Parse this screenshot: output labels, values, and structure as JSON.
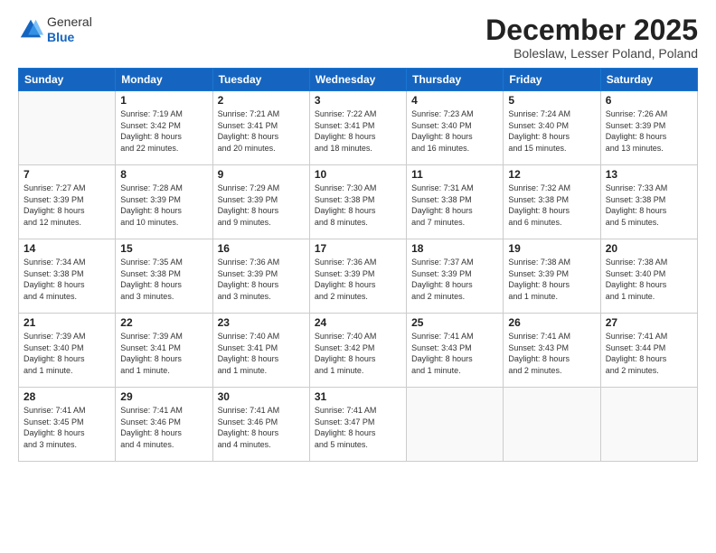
{
  "header": {
    "logo_line1": "General",
    "logo_line2": "Blue",
    "month_year": "December 2025",
    "location": "Boleslaw, Lesser Poland, Poland"
  },
  "weekdays": [
    "Sunday",
    "Monday",
    "Tuesday",
    "Wednesday",
    "Thursday",
    "Friday",
    "Saturday"
  ],
  "weeks": [
    [
      {
        "day": "",
        "info": ""
      },
      {
        "day": "1",
        "info": "Sunrise: 7:19 AM\nSunset: 3:42 PM\nDaylight: 8 hours\nand 22 minutes."
      },
      {
        "day": "2",
        "info": "Sunrise: 7:21 AM\nSunset: 3:41 PM\nDaylight: 8 hours\nand 20 minutes."
      },
      {
        "day": "3",
        "info": "Sunrise: 7:22 AM\nSunset: 3:41 PM\nDaylight: 8 hours\nand 18 minutes."
      },
      {
        "day": "4",
        "info": "Sunrise: 7:23 AM\nSunset: 3:40 PM\nDaylight: 8 hours\nand 16 minutes."
      },
      {
        "day": "5",
        "info": "Sunrise: 7:24 AM\nSunset: 3:40 PM\nDaylight: 8 hours\nand 15 minutes."
      },
      {
        "day": "6",
        "info": "Sunrise: 7:26 AM\nSunset: 3:39 PM\nDaylight: 8 hours\nand 13 minutes."
      }
    ],
    [
      {
        "day": "7",
        "info": "Sunrise: 7:27 AM\nSunset: 3:39 PM\nDaylight: 8 hours\nand 12 minutes."
      },
      {
        "day": "8",
        "info": "Sunrise: 7:28 AM\nSunset: 3:39 PM\nDaylight: 8 hours\nand 10 minutes."
      },
      {
        "day": "9",
        "info": "Sunrise: 7:29 AM\nSunset: 3:39 PM\nDaylight: 8 hours\nand 9 minutes."
      },
      {
        "day": "10",
        "info": "Sunrise: 7:30 AM\nSunset: 3:38 PM\nDaylight: 8 hours\nand 8 minutes."
      },
      {
        "day": "11",
        "info": "Sunrise: 7:31 AM\nSunset: 3:38 PM\nDaylight: 8 hours\nand 7 minutes."
      },
      {
        "day": "12",
        "info": "Sunrise: 7:32 AM\nSunset: 3:38 PM\nDaylight: 8 hours\nand 6 minutes."
      },
      {
        "day": "13",
        "info": "Sunrise: 7:33 AM\nSunset: 3:38 PM\nDaylight: 8 hours\nand 5 minutes."
      }
    ],
    [
      {
        "day": "14",
        "info": "Sunrise: 7:34 AM\nSunset: 3:38 PM\nDaylight: 8 hours\nand 4 minutes."
      },
      {
        "day": "15",
        "info": "Sunrise: 7:35 AM\nSunset: 3:38 PM\nDaylight: 8 hours\nand 3 minutes."
      },
      {
        "day": "16",
        "info": "Sunrise: 7:36 AM\nSunset: 3:39 PM\nDaylight: 8 hours\nand 3 minutes."
      },
      {
        "day": "17",
        "info": "Sunrise: 7:36 AM\nSunset: 3:39 PM\nDaylight: 8 hours\nand 2 minutes."
      },
      {
        "day": "18",
        "info": "Sunrise: 7:37 AM\nSunset: 3:39 PM\nDaylight: 8 hours\nand 2 minutes."
      },
      {
        "day": "19",
        "info": "Sunrise: 7:38 AM\nSunset: 3:39 PM\nDaylight: 8 hours\nand 1 minute."
      },
      {
        "day": "20",
        "info": "Sunrise: 7:38 AM\nSunset: 3:40 PM\nDaylight: 8 hours\nand 1 minute."
      }
    ],
    [
      {
        "day": "21",
        "info": "Sunrise: 7:39 AM\nSunset: 3:40 PM\nDaylight: 8 hours\nand 1 minute."
      },
      {
        "day": "22",
        "info": "Sunrise: 7:39 AM\nSunset: 3:41 PM\nDaylight: 8 hours\nand 1 minute."
      },
      {
        "day": "23",
        "info": "Sunrise: 7:40 AM\nSunset: 3:41 PM\nDaylight: 8 hours\nand 1 minute."
      },
      {
        "day": "24",
        "info": "Sunrise: 7:40 AM\nSunset: 3:42 PM\nDaylight: 8 hours\nand 1 minute."
      },
      {
        "day": "25",
        "info": "Sunrise: 7:41 AM\nSunset: 3:43 PM\nDaylight: 8 hours\nand 1 minute."
      },
      {
        "day": "26",
        "info": "Sunrise: 7:41 AM\nSunset: 3:43 PM\nDaylight: 8 hours\nand 2 minutes."
      },
      {
        "day": "27",
        "info": "Sunrise: 7:41 AM\nSunset: 3:44 PM\nDaylight: 8 hours\nand 2 minutes."
      }
    ],
    [
      {
        "day": "28",
        "info": "Sunrise: 7:41 AM\nSunset: 3:45 PM\nDaylight: 8 hours\nand 3 minutes."
      },
      {
        "day": "29",
        "info": "Sunrise: 7:41 AM\nSunset: 3:46 PM\nDaylight: 8 hours\nand 4 minutes."
      },
      {
        "day": "30",
        "info": "Sunrise: 7:41 AM\nSunset: 3:46 PM\nDaylight: 8 hours\nand 4 minutes."
      },
      {
        "day": "31",
        "info": "Sunrise: 7:41 AM\nSunset: 3:47 PM\nDaylight: 8 hours\nand 5 minutes."
      },
      {
        "day": "",
        "info": ""
      },
      {
        "day": "",
        "info": ""
      },
      {
        "day": "",
        "info": ""
      }
    ]
  ]
}
